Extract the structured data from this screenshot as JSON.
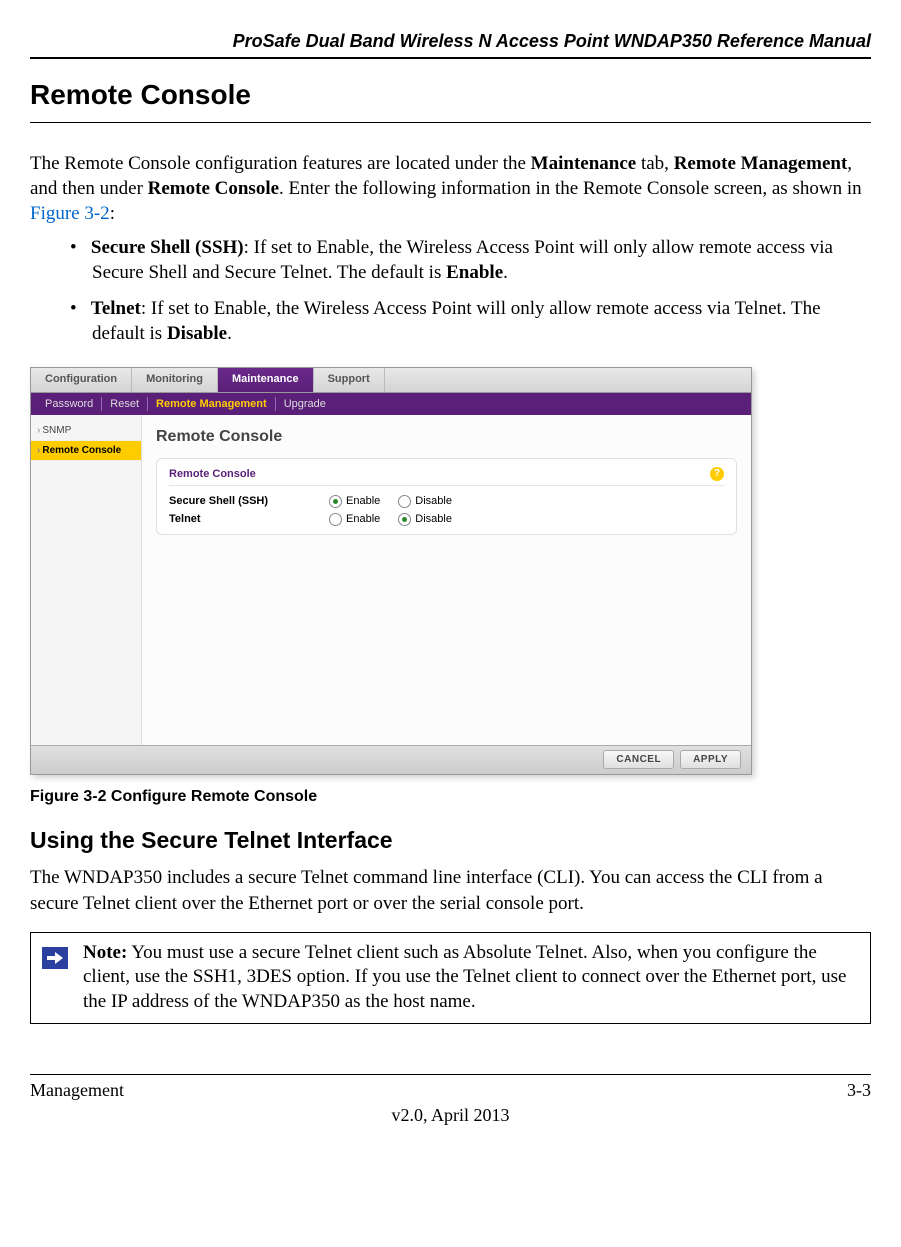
{
  "header": {
    "manual_title": "ProSafe Dual Band Wireless N Access Point WNDAP350 Reference Manual"
  },
  "section": {
    "title": "Remote Console",
    "intro_a": "The Remote Console configuration features are located under the ",
    "intro_b": "Maintenance",
    "intro_c": " tab, ",
    "intro_d": "Remote Management",
    "intro_e": ", and then under ",
    "intro_f": "Remote Console",
    "intro_g": ". Enter the following information in the Remote Console screen, as shown in ",
    "intro_link": "Figure 3-2",
    "intro_h": ":",
    "bullets": {
      "ssh_label": "Secure Shell (SSH)",
      "ssh_text_a": ": If set to Enable, the Wireless Access Point will only allow remote access via Secure Shell and Secure Telnet. The default is ",
      "ssh_text_b": "Enable",
      "ssh_text_c": ".",
      "telnet_label": "Telnet",
      "telnet_text_a": ": If set to Enable, the Wireless Access Point will only allow remote access via Telnet. The default is ",
      "telnet_text_b": "Disable",
      "telnet_text_c": "."
    }
  },
  "screenshot": {
    "tabs": {
      "configuration": "Configuration",
      "monitoring": "Monitoring",
      "maintenance": "Maintenance",
      "support": "Support"
    },
    "subtabs": {
      "password": "Password",
      "reset": "Reset",
      "remote_mgmt": "Remote Management",
      "upgrade": "Upgrade"
    },
    "sidebar": {
      "snmp": "SNMP",
      "remote_console": "Remote Console"
    },
    "panel": {
      "title": "Remote Console",
      "box_label": "Remote Console",
      "ssh_label": "Secure Shell (SSH)",
      "telnet_label": "Telnet",
      "enable": "Enable",
      "disable": "Disable"
    },
    "buttons": {
      "cancel": "CANCEL",
      "apply": "APPLY"
    }
  },
  "figure_caption": "Figure 3-2  Configure Remote Console",
  "subsection": {
    "title": "Using the Secure Telnet Interface",
    "body": "The WNDAP350 includes a secure Telnet command line interface (CLI). You can access the CLI from a secure Telnet client over the Ethernet port or over the serial console port."
  },
  "note": {
    "label": "Note:",
    "text": " You must use a secure Telnet client such as Absolute Telnet. Also, when you configure the client, use the SSH1, 3DES option. If you use the Telnet client to connect over the Ethernet port, use the IP address of the WNDAP350 as the host name."
  },
  "footer": {
    "left": "Management",
    "right": "3-3",
    "version": "v2.0, April 2013"
  }
}
